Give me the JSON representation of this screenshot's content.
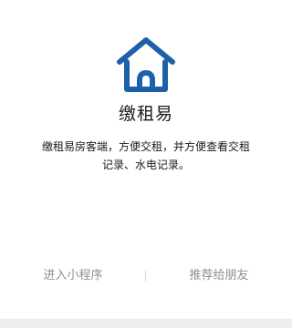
{
  "app": {
    "name": "缴租易",
    "description": "缴租易房客端，方便交租，并方便查看交租记录、水电记录。",
    "logo_icon": "house-icon",
    "brand_color": "#1d5fa8"
  },
  "actions": {
    "enter_label": "进入小程序",
    "share_label": "推荐给朋友",
    "separator": "|"
  }
}
